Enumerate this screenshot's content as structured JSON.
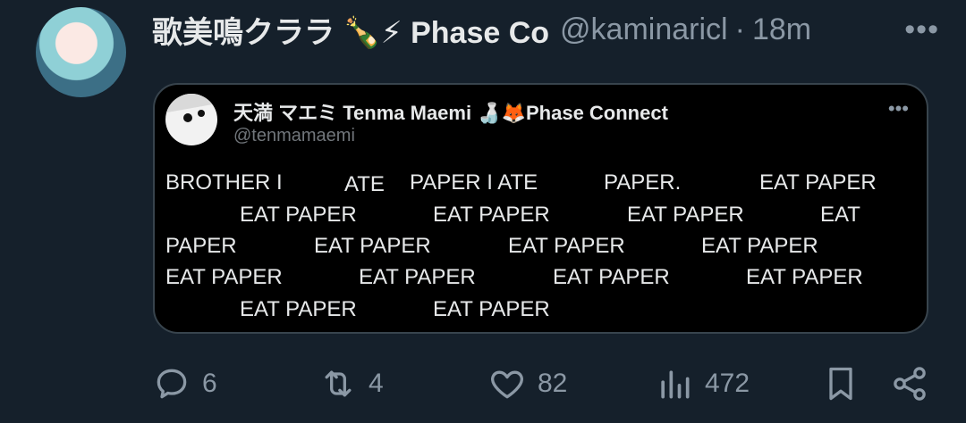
{
  "tweet": {
    "display_name": "歌美鳴クララ 🍾⚡ Phase Co",
    "handle": "@kaminaricl",
    "separator": "·",
    "time": "18m",
    "more": "•••"
  },
  "quoted": {
    "display_name": "天満 マエミ Tenma Maemi 🍶🦊Phase Connect",
    "handle": "@tenmamaemi",
    "more": "•••",
    "text_fragments": [
      "BROTHER I",
      "ATE",
      "PAPER I ATE",
      "PAPER.",
      "EAT PAPER",
      "EAT PAPER",
      "EAT PAPER",
      "EAT PAPER",
      "EAT",
      "PAPER",
      "EAT PAPER",
      "EAT PAPER",
      "EAT PAPER",
      "EAT PAPER",
      "EAT PAPER",
      "EAT PAPER",
      "EAT PAPER",
      "EAT PAPER",
      "EAT PAPER"
    ]
  },
  "actions": {
    "replies": "6",
    "retweets": "4",
    "likes": "82",
    "views": "472"
  },
  "colors": {
    "background": "#15202b",
    "quote_background": "#000000",
    "text": "#e7e9ea",
    "muted": "#8b98a5",
    "border": "#38444d"
  }
}
